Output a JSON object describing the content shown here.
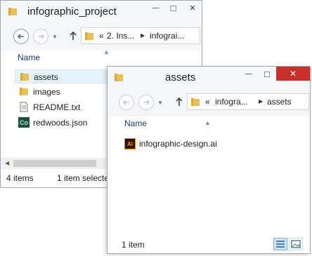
{
  "colors": {
    "accent": "#1f3b6e",
    "close_red": "#c9302c",
    "folder": "#e8c05a",
    "selection": "#e5f3fb"
  },
  "back_window": {
    "title": "infographic_project",
    "breadcrumb": {
      "overflow": "«",
      "parts": [
        "2. Ins...",
        "infograi..."
      ]
    },
    "column_header": "Name",
    "items": [
      {
        "name": "assets",
        "icon": "folder-icon",
        "selected": true
      },
      {
        "name": "images",
        "icon": "folder-icon",
        "selected": false
      },
      {
        "name": "README.txt",
        "icon": "text-file-icon",
        "selected": false
      },
      {
        "name": "redwoods.json",
        "icon": "json-file-icon",
        "badge": "Co",
        "selected": false
      }
    ],
    "status": {
      "count": "4 items",
      "selection": "1 item selecte"
    }
  },
  "front_window": {
    "title": "assets",
    "breadcrumb": {
      "overflow": "«",
      "parts": [
        "infogra...",
        "assets"
      ]
    },
    "column_header": "Name",
    "items": [
      {
        "name": "infographic-design.ai",
        "icon": "illustrator-file-icon",
        "badge": "Ai"
      }
    ],
    "status": {
      "count": "1 item"
    },
    "minimize_glyph": "—",
    "maximize_glyph": "□",
    "close_glyph": "✕"
  }
}
